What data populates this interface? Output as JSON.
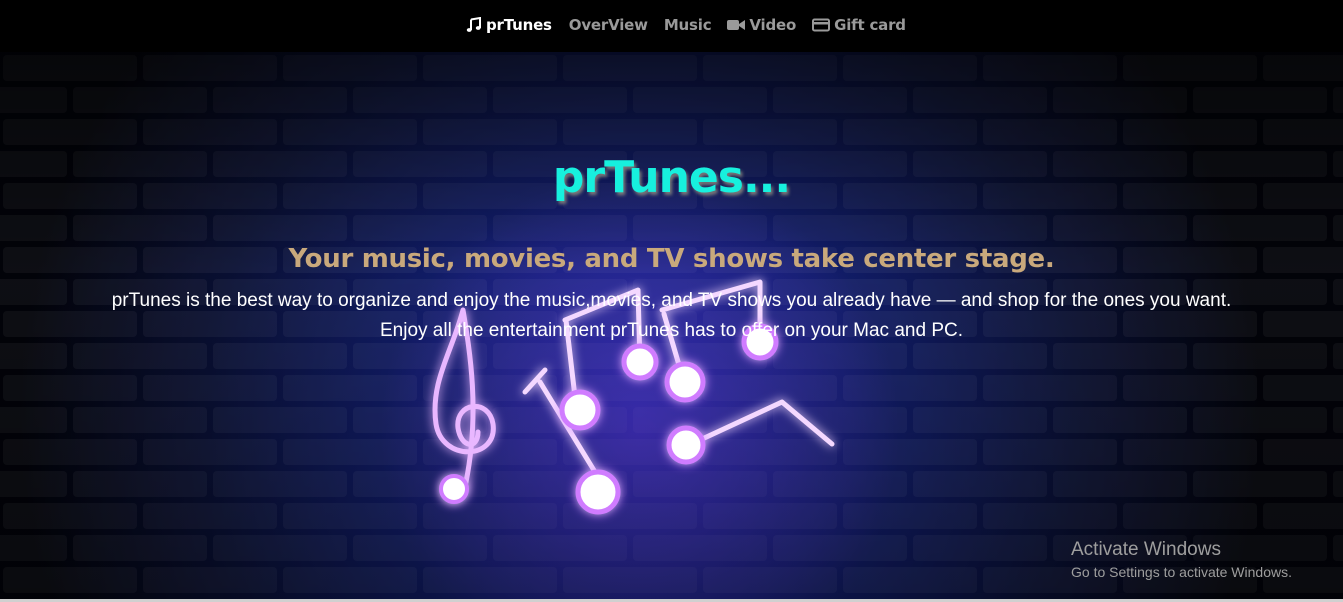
{
  "nav": {
    "brand_label": "prTunes",
    "brand_icon": "music-note-icon",
    "items": [
      {
        "label": "OverView"
      },
      {
        "label": "Music"
      },
      {
        "label": "Video",
        "icon": "video-camera-icon"
      },
      {
        "label": "Gift card",
        "icon": "credit-card-icon"
      }
    ]
  },
  "hero": {
    "title": "prTunes...",
    "subtitle": "Your music, movies, and TV shows take center stage.",
    "description": "prTunes is the best way to organize and enjoy the music,movies, and TV shows you already have — and shop for the ones you want. Enjoy all the entertainment prTunes has to offer on your Mac and PC.",
    "background": "neon-music-notes-brick-wall",
    "colors": {
      "title": "#17f0de",
      "subtitle": "#c9a97c",
      "neon": "#c35cff"
    }
  },
  "os_watermark": {
    "title": "Activate Windows",
    "subtitle": "Go to Settings to activate Windows."
  }
}
